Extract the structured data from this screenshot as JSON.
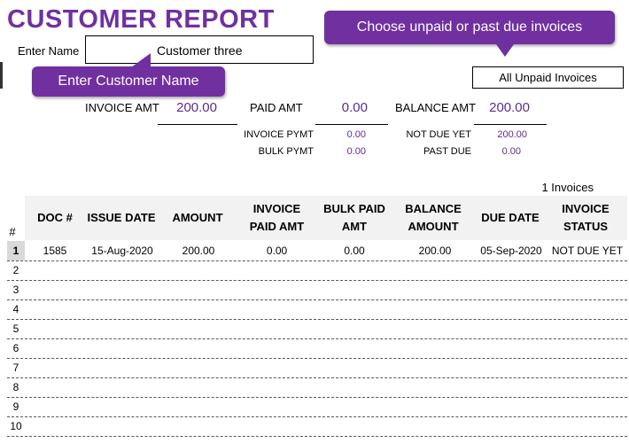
{
  "report": {
    "title": "CUSTOMER REPORT",
    "enter_name_label": "Enter Name",
    "customer_name": "Customer three",
    "filter_value": "All Unpaid Invoices",
    "callout_filter": "Choose unpaid or past due invoices",
    "callout_name": "Enter Customer Name"
  },
  "summary": {
    "invoice_amt_label": "INVOICE AMT",
    "invoice_amt": "200.00",
    "paid_amt_label": "PAID AMT",
    "paid_amt": "0.00",
    "balance_amt_label": "BALANCE AMT",
    "balance_amt": "200.00",
    "invoice_pymt_label": "INVOICE  PYMT",
    "invoice_pymt": "0.00",
    "bulk_pymt_label": "BULK PYMT",
    "bulk_pymt": "0.00",
    "not_due_label": "NOT DUE YET",
    "not_due": "200.00",
    "past_due_label": "PAST DUE",
    "past_due": "0.00"
  },
  "invoice_count": "1 Invoices",
  "table": {
    "rownum_header": "#",
    "columns": [
      "DOC #",
      "ISSUE DATE",
      "AMOUNT",
      "INVOICE PAID AMT",
      "BULK PAID AMT",
      "BALANCE AMOUNT",
      "DUE DATE",
      "INVOICE STATUS"
    ],
    "rows": [
      {
        "num": "1",
        "doc": "1585",
        "issue_date": "15-Aug-2020",
        "amount": "200.00",
        "inv_paid": "0.00",
        "bulk_paid": "0.00",
        "balance": "200.00",
        "due_date": "05-Sep-2020",
        "status": "NOT DUE YET"
      },
      {
        "num": "2"
      },
      {
        "num": "3"
      },
      {
        "num": "4"
      },
      {
        "num": "5"
      },
      {
        "num": "6"
      },
      {
        "num": "7"
      },
      {
        "num": "8"
      },
      {
        "num": "9"
      },
      {
        "num": "10"
      }
    ]
  }
}
